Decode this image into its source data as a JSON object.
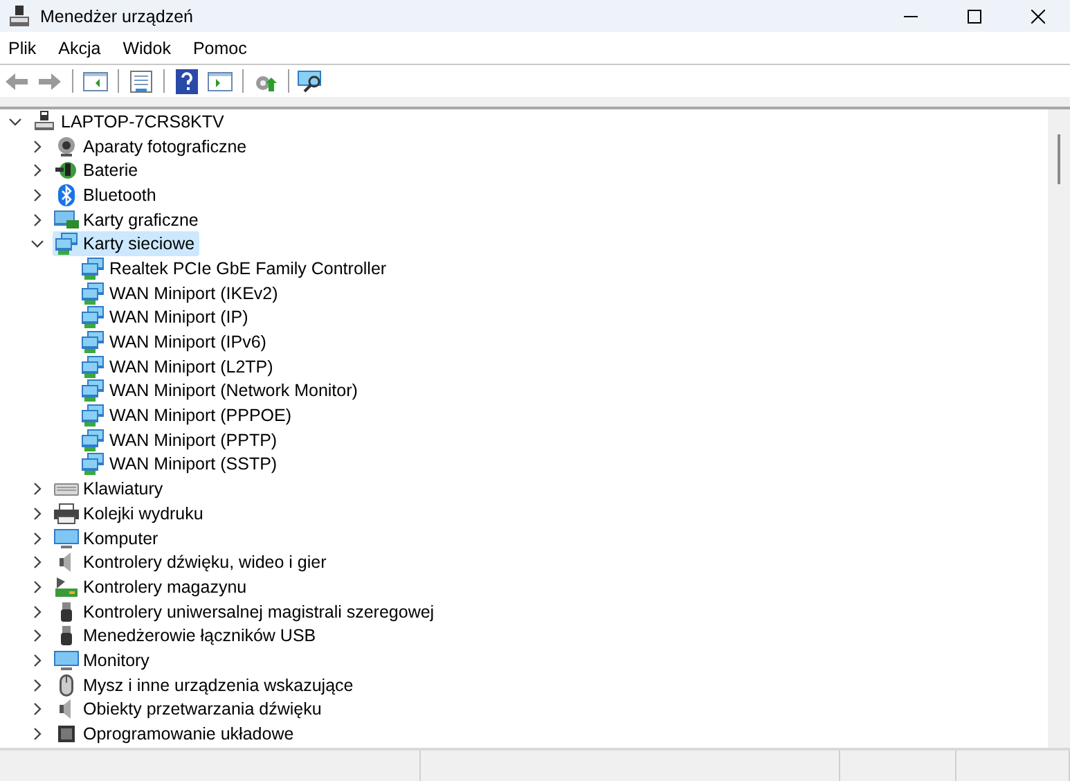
{
  "window": {
    "title": "Menedżer urządzeń"
  },
  "menu": [
    {
      "label": "Plik"
    },
    {
      "label": "Akcja"
    },
    {
      "label": "Widok"
    },
    {
      "label": "Pomoc"
    }
  ],
  "toolbar": {
    "back_disabled": true,
    "forward_disabled": true
  },
  "tree": {
    "label": "LAPTOP-7CRS8KTV",
    "expanded": true,
    "selected": false,
    "children": [
      {
        "label": "Aparaty fotograficzne",
        "expanded": false,
        "selected": false
      },
      {
        "label": "Baterie",
        "expanded": false,
        "selected": false
      },
      {
        "label": "Bluetooth",
        "expanded": false,
        "selected": false
      },
      {
        "label": "Karty graficzne",
        "expanded": false,
        "selected": false
      },
      {
        "label": "Karty sieciowe",
        "expanded": true,
        "selected": true,
        "children": [
          {
            "label": "Realtek PCIe GbE Family Controller",
            "selected": false
          },
          {
            "label": "WAN Miniport (IKEv2)",
            "selected": false
          },
          {
            "label": "WAN Miniport (IP)",
            "selected": false
          },
          {
            "label": "WAN Miniport (IPv6)",
            "selected": false
          },
          {
            "label": "WAN Miniport (L2TP)",
            "selected": false
          },
          {
            "label": "WAN Miniport (Network Monitor)",
            "selected": false
          },
          {
            "label": "WAN Miniport (PPPOE)",
            "selected": false
          },
          {
            "label": "WAN Miniport (PPTP)",
            "selected": false
          },
          {
            "label": "WAN Miniport (SSTP)",
            "selected": false
          }
        ]
      },
      {
        "label": "Klawiatury",
        "expanded": false,
        "selected": false
      },
      {
        "label": "Kolejki wydruku",
        "expanded": false,
        "selected": false
      },
      {
        "label": "Komputer",
        "expanded": false,
        "selected": false
      },
      {
        "label": "Kontrolery dźwięku, wideo i gier",
        "expanded": false,
        "selected": false
      },
      {
        "label": "Kontrolery magazynu",
        "expanded": false,
        "selected": false
      },
      {
        "label": "Kontrolery uniwersalnej magistrali szeregowej",
        "expanded": false,
        "selected": false
      },
      {
        "label": "Menedżerowie łączników USB",
        "expanded": false,
        "selected": false
      },
      {
        "label": "Monitory",
        "expanded": false,
        "selected": false
      },
      {
        "label": "Mysz i inne urządzenia wskazujące",
        "expanded": false,
        "selected": false
      },
      {
        "label": "Obiekty przetwarzania dźwięku",
        "expanded": false,
        "selected": false
      },
      {
        "label": "Oprogramowanie układowe",
        "expanded": false,
        "selected": false
      }
    ]
  }
}
